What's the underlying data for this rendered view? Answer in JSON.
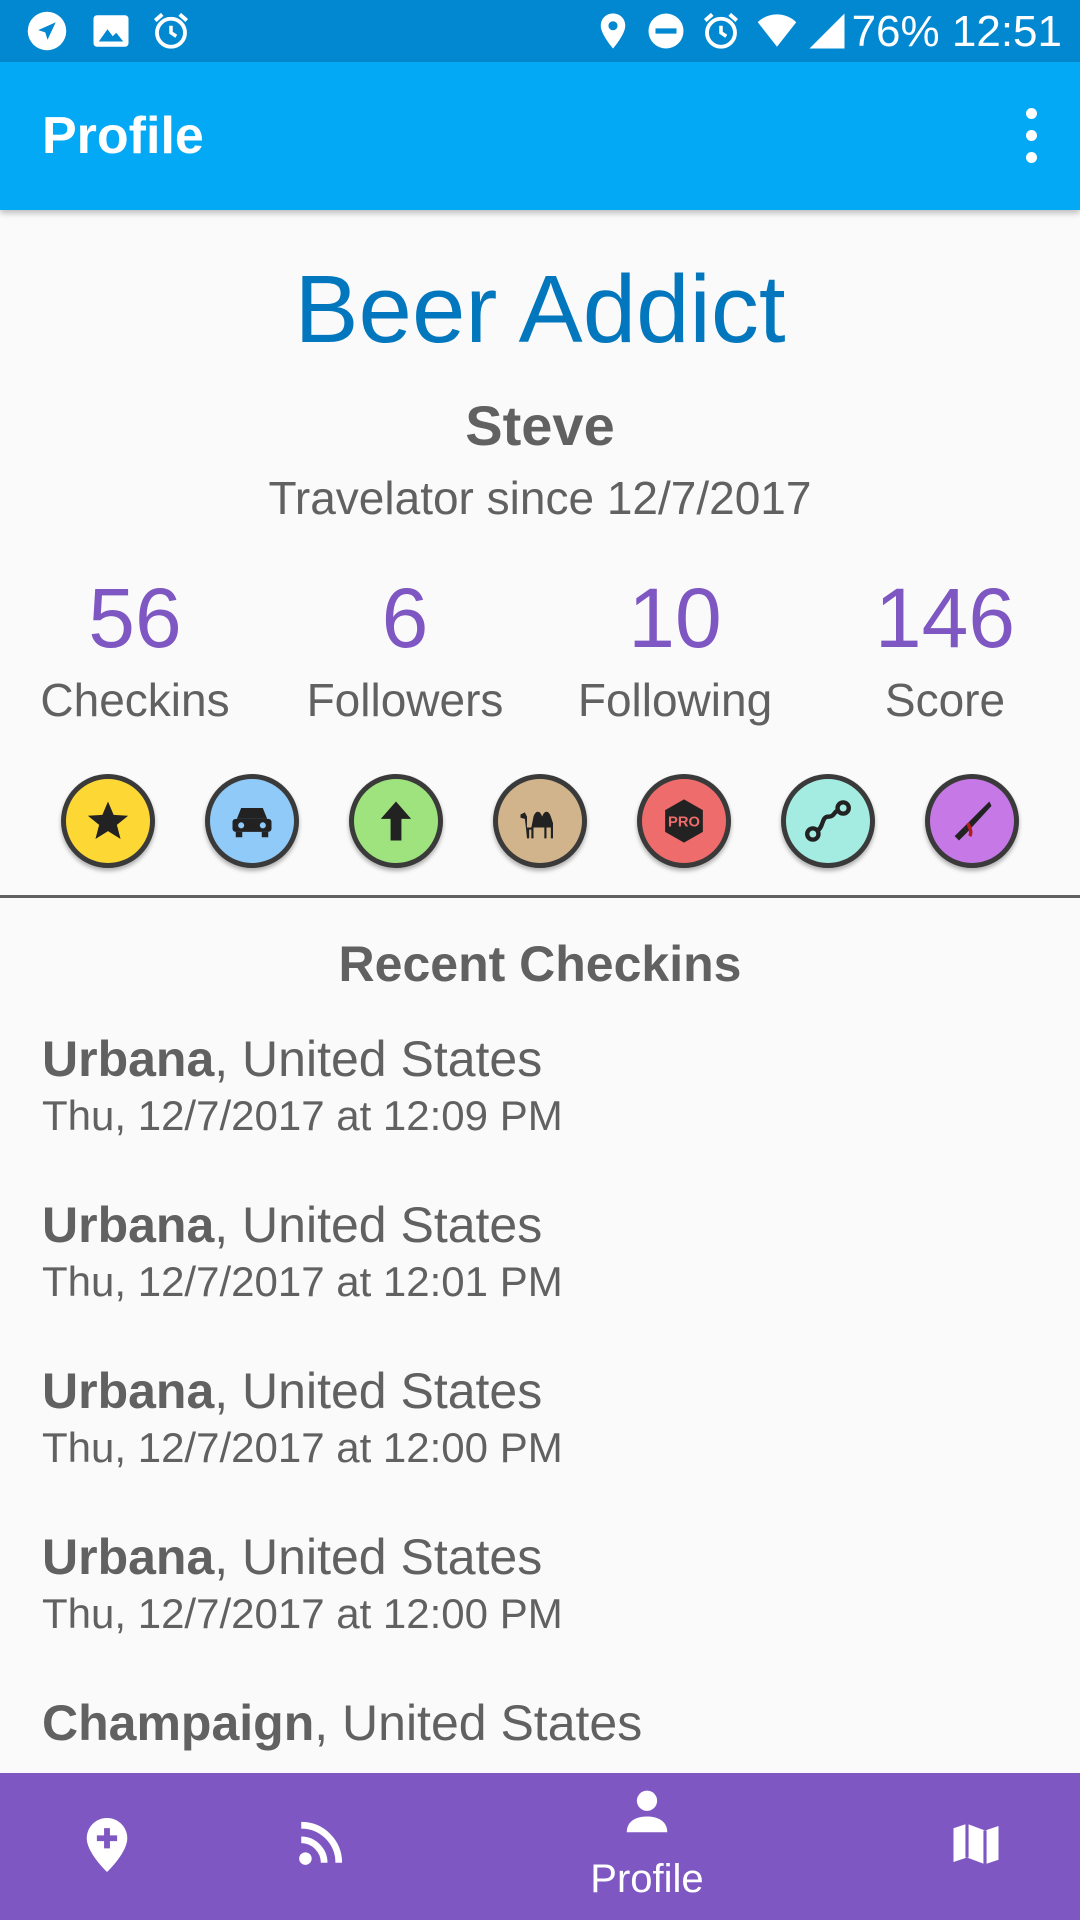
{
  "status_bar": {
    "battery": "76%",
    "time": "12:51",
    "left_icons": [
      "navigation-icon",
      "image-icon",
      "alarm-icon"
    ],
    "right_icons": [
      "location-icon",
      "do-not-disturb-icon",
      "alarm-icon",
      "wifi-icon",
      "signal-icon"
    ]
  },
  "app_bar": {
    "title": "Profile",
    "menu_icon": "more-vert-icon"
  },
  "profile": {
    "rank": "Beer Addict",
    "name": "Steve",
    "member_since": "Travelator since 12/7/2017"
  },
  "stats": [
    {
      "value": "56",
      "label": "Checkins"
    },
    {
      "value": "6",
      "label": "Followers"
    },
    {
      "value": "10",
      "label": "Following"
    },
    {
      "value": "146",
      "label": "Score"
    }
  ],
  "badges": [
    {
      "icon": "star-icon",
      "color": "#fdd835"
    },
    {
      "icon": "car-icon",
      "color": "#90caf9"
    },
    {
      "icon": "arrow-up-icon",
      "color": "#9ee37d"
    },
    {
      "icon": "camel-icon",
      "color": "#d2b48c"
    },
    {
      "icon": "pro-icon",
      "color": "#ef6c6c",
      "text": "PRO"
    },
    {
      "icon": "route-icon",
      "color": "#a4ece1"
    },
    {
      "icon": "knife-icon",
      "color": "#c678e6"
    }
  ],
  "recent": {
    "heading": "Recent Checkins",
    "items": [
      {
        "city": "Urbana",
        "country": ", United States",
        "time": "Thu, 12/7/2017 at 12:09 PM"
      },
      {
        "city": "Urbana",
        "country": ", United States",
        "time": "Thu, 12/7/2017 at 12:01 PM"
      },
      {
        "city": "Urbana",
        "country": ", United States",
        "time": "Thu, 12/7/2017 at 12:00 PM"
      },
      {
        "city": "Urbana",
        "country": ", United States",
        "time": "Thu, 12/7/2017 at 12:00 PM"
      },
      {
        "city": "Champaign",
        "country": ", United States",
        "time": ""
      }
    ]
  },
  "bottom_nav": {
    "items": [
      {
        "icon": "add-location-icon",
        "label": ""
      },
      {
        "icon": "feed-icon",
        "label": ""
      },
      {
        "icon": "person-icon",
        "label": "Profile"
      },
      {
        "icon": "map-icon",
        "label": ""
      }
    ]
  },
  "colors": {
    "status_bar": "#0288d1",
    "app_bar": "#03a9f4",
    "rank_text": "#0277bd",
    "stat_value": "#7e57c2",
    "bottom_nav": "#7e57c2"
  }
}
